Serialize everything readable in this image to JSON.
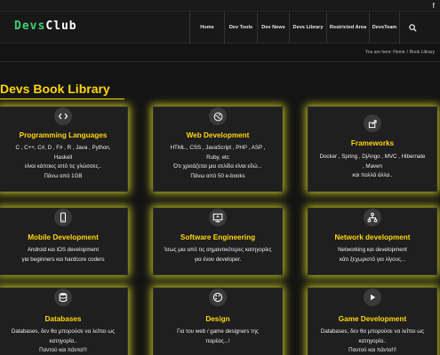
{
  "topbar": {
    "social_icon": "facebook-icon",
    "social_label": "f"
  },
  "header": {
    "logo_part1": "Devs",
    "logo_part2": "Club",
    "nav": [
      "Home",
      "Dev Tools",
      "Dev News",
      "Devs Library",
      "Restricted Area",
      "DevsTeam"
    ],
    "search_icon": "search-icon"
  },
  "breadcrumb": {
    "prefix": "You are here:",
    "home": "Home",
    "current": "Book Library"
  },
  "page_title": "Devs Book Library",
  "colors": {
    "accent": "#ffd60a",
    "logo_green": "#3cd070",
    "glow": "#dadc23",
    "background": "#141414",
    "card": "#1f1f1f"
  },
  "cards": [
    {
      "icon": "code-icon",
      "title": "Programming Languages",
      "lines": [
        "C , C++, C#, D , F# , R , Java , Python,",
        "Haskell",
        "είναι κάποιες από τις γλώσσες..",
        "Πάνω από 1GB"
      ]
    },
    {
      "icon": "globe-icon",
      "title": "Web Development",
      "lines": [
        "HTML , CSS , JavaScript , PHP , ASP ,",
        "Ruby, etc",
        "Ότι χρειάζεται μια σελίδα είναι εδώ...",
        "Πάνω από 50 e-books"
      ]
    },
    {
      "icon": "share-icon",
      "title": "Frameworks",
      "lines": [
        "Docker , Spring , DjAngo , MVC , Hibernate",
        ", Maven",
        "και πολλά άλλα.."
      ]
    },
    {
      "icon": "mobile-icon",
      "title": "Mobile Development",
      "lines": [
        "Android και iOS development",
        "για beginners και hardcore coders"
      ]
    },
    {
      "icon": "monitor-icon",
      "title": "Software Engineering",
      "lines": [
        "Ίσως μια από τις σημαντικότερες κατηγορίες",
        "για έναν developer."
      ]
    },
    {
      "icon": "network-icon",
      "title": "Network development",
      "lines": [
        "Networking και development",
        "κάτι ξεχωριστό για λίγους..."
      ]
    },
    {
      "icon": "database-icon",
      "title": "Databases",
      "lines": [
        "Databases, δεν θα μπορούσε να λείπει ως",
        "κατηγορία..",
        "Παντού και πάντα!!!"
      ]
    },
    {
      "icon": "design-icon",
      "title": "Design",
      "lines": [
        "Για του web / game designers της",
        "παρέας...!"
      ]
    },
    {
      "icon": "play-icon",
      "title": "Game Development",
      "lines": [
        "Databases, δεν θα μπορούσε να λείπει ως",
        "κατηγορία..",
        "Παντού και πάντα!!!"
      ]
    }
  ]
}
